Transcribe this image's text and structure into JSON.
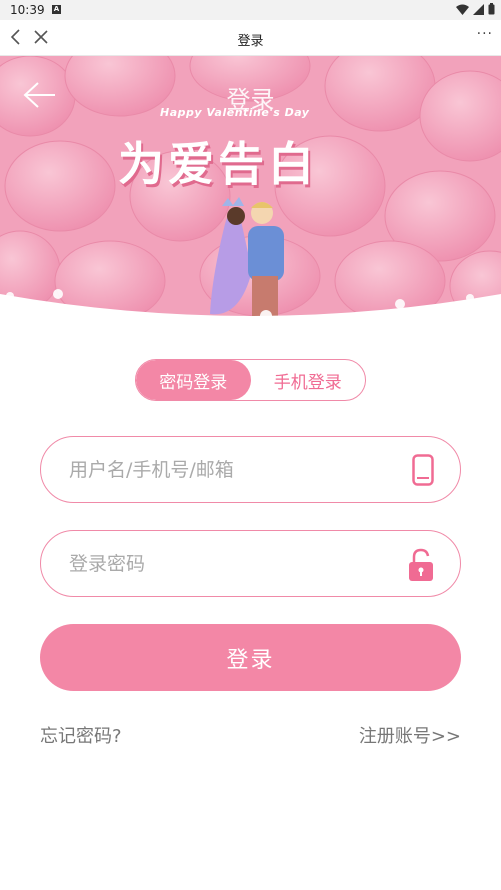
{
  "status_bar": {
    "time": "10:39",
    "notification_badge": "A"
  },
  "nav": {
    "title": "登录",
    "more": "···",
    "icons": [
      "back-icon",
      "close-icon",
      "more-icon"
    ]
  },
  "hero": {
    "title": "登录",
    "subtitle": "Happy Valentine's Day",
    "headline": "为爱告白",
    "icons": [
      "arrow-left-icon"
    ]
  },
  "tabs": [
    {
      "label": "密码登录",
      "active": true
    },
    {
      "label": "手机登录",
      "active": false
    }
  ],
  "form": {
    "username_placeholder": "用户名/手机号/邮箱",
    "password_placeholder": "登录密码",
    "username_value": "",
    "password_value": "",
    "username_icon": "phone-icon",
    "password_icon": "lock-icon"
  },
  "login_button": "登录",
  "links": {
    "forgot": "忘记密码?",
    "register": "注册账号>>"
  },
  "colors": {
    "accent": "#f387a6",
    "accent_border": "#f08aa8",
    "hero_pink": "#f4a7bf"
  }
}
